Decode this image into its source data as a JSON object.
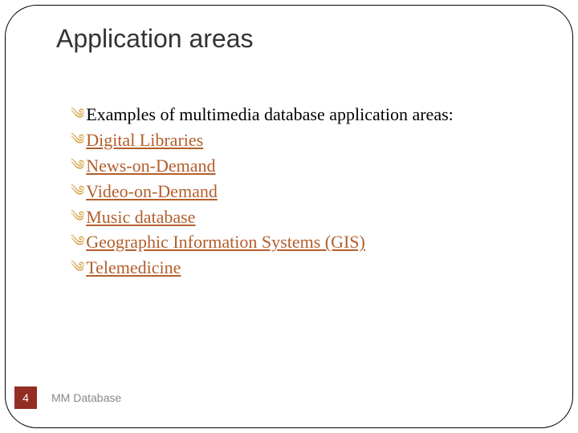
{
  "slide": {
    "title": "Application areas",
    "bullets": [
      {
        "text": "Examples of multimedia database application areas:",
        "link": false
      },
      {
        "text": "Digital Libraries",
        "link": true
      },
      {
        "text": "News-on-Demand",
        "link": true
      },
      {
        "text": "Video-on-Demand",
        "link": true
      },
      {
        "text": "Music database",
        "link": true
      },
      {
        "text": "Geographic Information Systems (GIS)",
        "link": true
      },
      {
        "text": "Telemedicine",
        "link": true
      }
    ],
    "footer": {
      "pageNumber": "4",
      "label": "MM Database"
    }
  }
}
